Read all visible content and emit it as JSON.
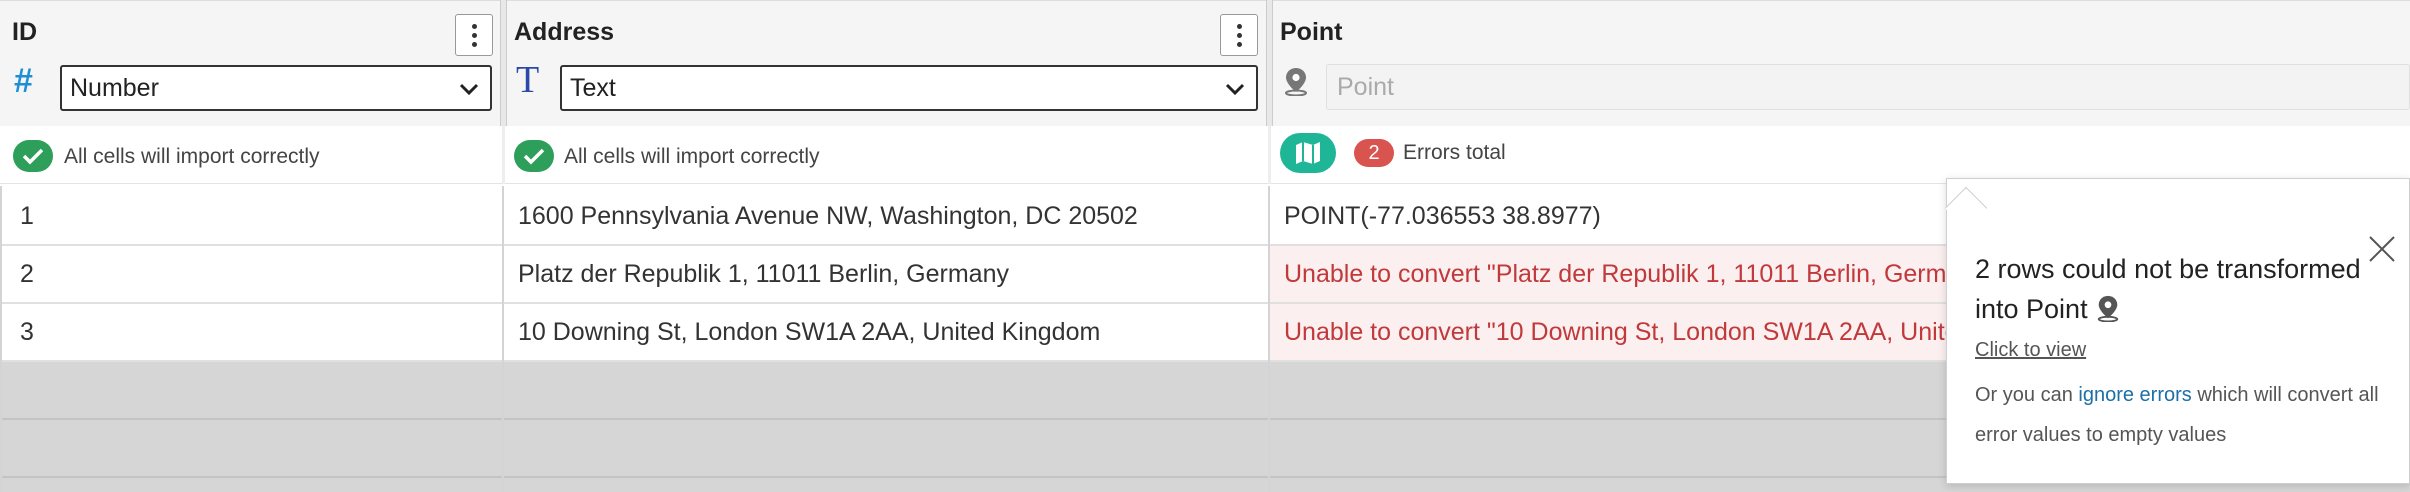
{
  "columns": [
    {
      "title": "ID",
      "type_icon": "hash-icon",
      "type_value": "Number",
      "status": "All cells will import correctly"
    },
    {
      "title": "Address",
      "type_icon": "text-type-icon",
      "type_value": "Text",
      "status": "All cells will import correctly"
    },
    {
      "title": "Point",
      "type_icon": "map-pin-icon",
      "type_placeholder": "Point",
      "error_count": "2",
      "error_label": "Errors total"
    }
  ],
  "rows": [
    {
      "id": "1",
      "address": "1600 Pennsylvania Avenue NW, Washington, DC 20502",
      "point": "POINT(-77.036553 38.8977)",
      "error": false
    },
    {
      "id": "2",
      "address": "Platz der Republik 1, 11011 Berlin, Germany",
      "point": "Unable to convert \"Platz der Republik 1, 11011 Berlin, Germ",
      "error": true
    },
    {
      "id": "3",
      "address": "10 Downing St, London SW1A 2AA, United Kingdom",
      "point": "Unable to convert \"10 Downing St, London SW1A 2AA, Unite",
      "error": true
    }
  ],
  "popover": {
    "title": "2 rows could not be transformed into Point",
    "view_link": "Click to view",
    "body_prefix": "Or you can",
    "ignore_link": "ignore errors",
    "body_suffix": "which will convert all error values to empty values"
  },
  "colors": {
    "accent_blue": "#1e8fd5",
    "text_type_blue": "#2b4aa8",
    "success": "#2e9e5b",
    "error": "#d9534f",
    "map_button": "#1fb597"
  }
}
